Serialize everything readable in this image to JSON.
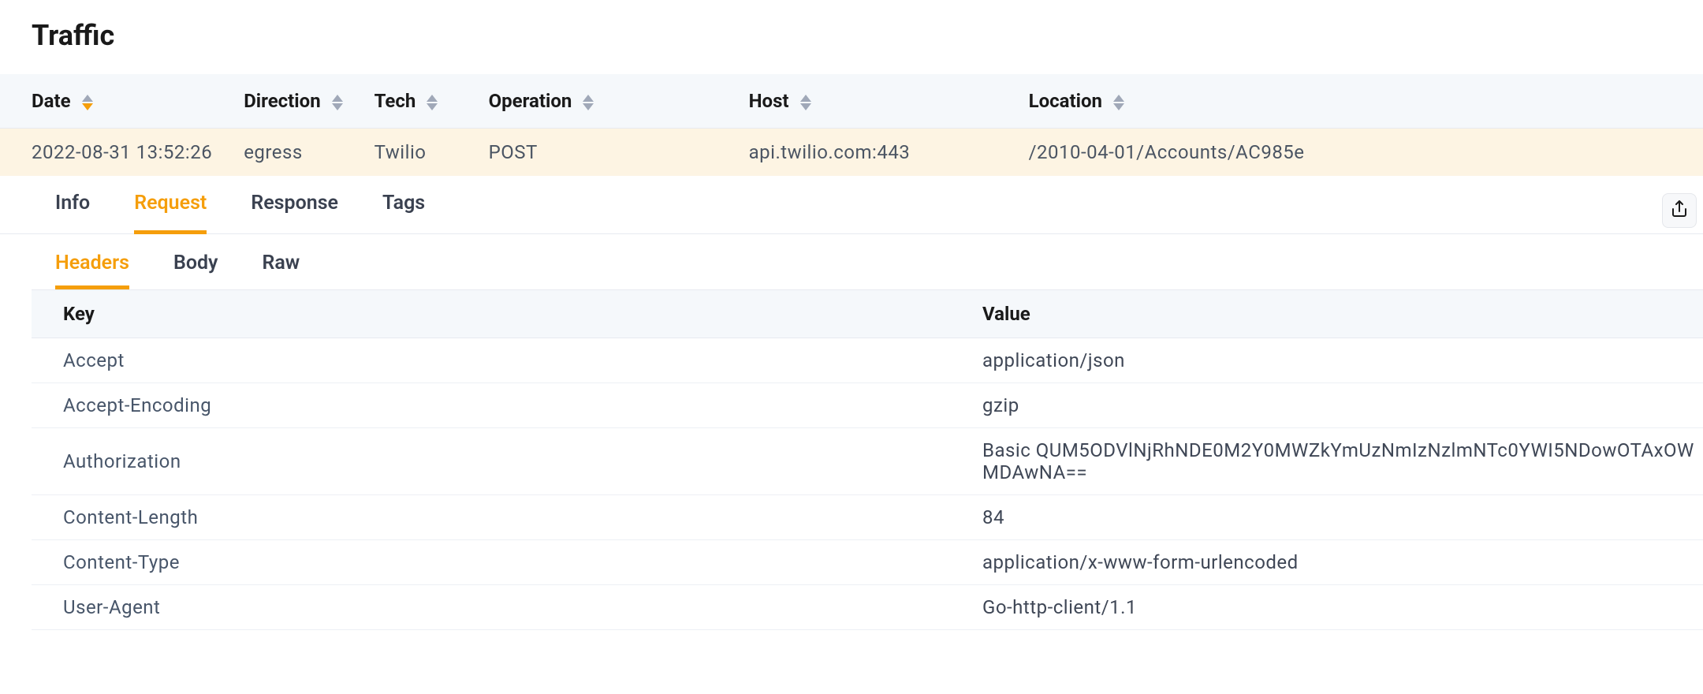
{
  "title": "Traffic",
  "traffic_columns": {
    "date": "Date",
    "direction": "Direction",
    "tech": "Tech",
    "operation": "Operation",
    "host": "Host",
    "location": "Location"
  },
  "traffic_rows": [
    {
      "date": "2022-08-31 13:52:26",
      "direction": "egress",
      "tech": "Twilio",
      "operation": "POST",
      "host": "api.twilio.com:443",
      "location": "/2010-04-01/Accounts/AC985e"
    }
  ],
  "primary_tabs": {
    "info": "Info",
    "request": "Request",
    "response": "Response",
    "tags": "Tags",
    "active": "request"
  },
  "secondary_tabs": {
    "headers": "Headers",
    "body": "Body",
    "raw": "Raw",
    "active": "headers"
  },
  "headers_columns": {
    "key": "Key",
    "value": "Value"
  },
  "headers": [
    {
      "key": "Accept",
      "value": "application/json"
    },
    {
      "key": "Accept-Encoding",
      "value": "gzip"
    },
    {
      "key": "Authorization",
      "value": "Basic QUM5ODVlNjRhNDE0M2Y0MWZkYmUzNmIzNzlmNTc0YWI5NDowOTAxOWMDAwNA=="
    },
    {
      "key": "Content-Length",
      "value": "84"
    },
    {
      "key": "Content-Type",
      "value": "application/x-www-form-urlencoded"
    },
    {
      "key": "User-Agent",
      "value": "Go-http-client/1.1"
    }
  ],
  "icons": {
    "export": "export-icon",
    "sort": "sort-icon"
  },
  "colors": {
    "accent": "#f59e0b",
    "row_selected_bg": "#fdf4e3",
    "header_bg": "#f5f8fb",
    "text_muted": "#4b5563"
  }
}
